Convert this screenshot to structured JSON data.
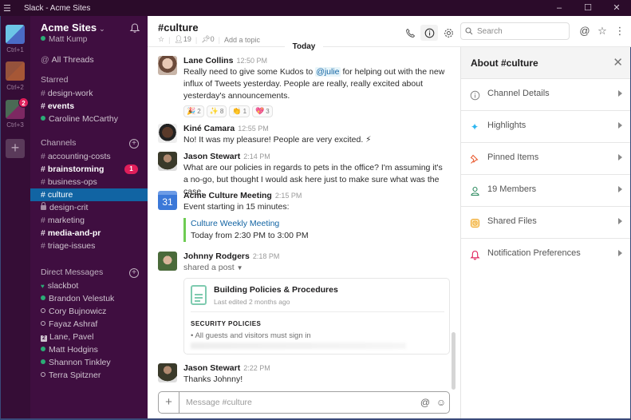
{
  "window": {
    "title": "Slack - Acme Sites",
    "menu_icon": "hamburger-icon",
    "controls": [
      "minimize",
      "maximize",
      "close"
    ]
  },
  "workspaces": [
    {
      "shortcut": "Ctrl+1",
      "badge": null
    },
    {
      "shortcut": "Ctrl+2",
      "badge": null
    },
    {
      "shortcut": "Ctrl+3",
      "badge": "2"
    }
  ],
  "sidebar": {
    "team_name": "Acme Sites",
    "user_name": "Matt Kump",
    "all_threads": "All Threads",
    "starred_header": "Starred",
    "starred": [
      {
        "type": "channel",
        "label": "design-work",
        "bold": false
      },
      {
        "type": "channel",
        "label": "events",
        "bold": true
      },
      {
        "type": "dm",
        "label": "Caroline McCarthy",
        "status": "online"
      }
    ],
    "channels_header": "Channels",
    "channels": [
      {
        "label": "accounting-costs",
        "bold": false,
        "private": false
      },
      {
        "label": "brainstorming",
        "bold": true,
        "private": false,
        "badge": "1"
      },
      {
        "label": "business-ops",
        "bold": false,
        "private": false
      },
      {
        "label": "culture",
        "bold": false,
        "private": false,
        "selected": true
      },
      {
        "label": "design-crit",
        "bold": false,
        "private": true
      },
      {
        "label": "marketing",
        "bold": false,
        "private": false
      },
      {
        "label": "media-and-pr",
        "bold": true,
        "private": false
      },
      {
        "label": "triage-issues",
        "bold": false,
        "private": false
      }
    ],
    "dm_header": "Direct Messages",
    "dms": [
      {
        "label": "slackbot",
        "status": "bot"
      },
      {
        "label": "Brandon Velestuk",
        "status": "online"
      },
      {
        "label": "Cory Bujnowicz",
        "status": "away"
      },
      {
        "label": "Fayaz Ashraf",
        "status": "away"
      },
      {
        "label": "Lane, Pavel",
        "status": "group",
        "group_count": "2"
      },
      {
        "label": "Matt Hodgins",
        "status": "online"
      },
      {
        "label": "Shannon Tinkley",
        "status": "online"
      },
      {
        "label": "Terra Spitzner",
        "status": "away"
      }
    ]
  },
  "channel": {
    "name": "#culture",
    "members": "19",
    "pins": "0",
    "topic_placeholder": "Add a topic",
    "day_divider": "Today"
  },
  "messages": [
    {
      "author": "Lane Collins",
      "time": "12:50 PM",
      "text_before": "Really need to give some Kudos to ",
      "mention": "@julie",
      "text_after": " for helping out with the new influx of Tweets yesterday. People are really, really excited about yesterday's announcements.",
      "reactions": [
        {
          "emoji": "🎉",
          "name": "tada",
          "count": "2"
        },
        {
          "emoji": "✨",
          "name": "sparkles",
          "count": "8"
        },
        {
          "emoji": "👏",
          "name": "clap",
          "count": "1"
        },
        {
          "emoji": "💖",
          "name": "heart",
          "count": "3"
        }
      ]
    },
    {
      "author": "Kiné Camara",
      "time": "12:55 PM",
      "text": "No! It was my pleasure! People are very excited. ⚡"
    },
    {
      "author": "Jason Stewart",
      "time": "2:14 PM",
      "text": "What are our policies in regards to pets in the office? I'm assuming it's a no-go, but thought I would ask here just to make sure what was the case."
    },
    {
      "author": "Acme Culture Meeting",
      "time": "2:15 PM",
      "calendar_day": "31",
      "text": "Event starting in 15 minutes:",
      "attachment": {
        "title": "Culture Weekly Meeting",
        "subtitle": "Today from 2:30 PM to 3:00 PM"
      }
    },
    {
      "author": "Johnny Rodgers",
      "time": "2:18 PM",
      "text": "shared a post",
      "post": {
        "title": "Building Policies & Procedures",
        "subtitle": "Last edited 2 months ago",
        "section": "SECURITY POLICIES",
        "bullet": "All guests and visitors must sign in"
      }
    },
    {
      "author": "Jason Stewart",
      "time": "2:22 PM",
      "text": "Thanks Johnny!"
    }
  ],
  "composer": {
    "placeholder": "Message #culture",
    "value": ""
  },
  "search": {
    "placeholder": "Search",
    "value": ""
  },
  "panel": {
    "title": "About #culture",
    "items": [
      {
        "label": "Channel Details",
        "icon": "info-icon",
        "color": "#868686"
      },
      {
        "label": "Highlights",
        "icon": "sparkle-icon",
        "color": "#2eb6f0"
      },
      {
        "label": "Pinned Items",
        "icon": "pin-icon",
        "color": "#e8562a"
      },
      {
        "label": "19 Members",
        "icon": "member-icon",
        "color": "#2b8a5e"
      },
      {
        "label": "Shared Files",
        "icon": "file-icon",
        "color": "#f0a82e"
      },
      {
        "label": "Notification Preferences",
        "icon": "bell-icon",
        "color": "#e01e5a"
      }
    ]
  },
  "colors": {
    "sidebar_bg": "#3f0e40",
    "rail_bg": "#350d36",
    "selected": "#1164a3",
    "online": "#2bac76",
    "badge": "#e01e5a",
    "link": "#1264a3",
    "attachment_bar": "#6ecc53"
  }
}
